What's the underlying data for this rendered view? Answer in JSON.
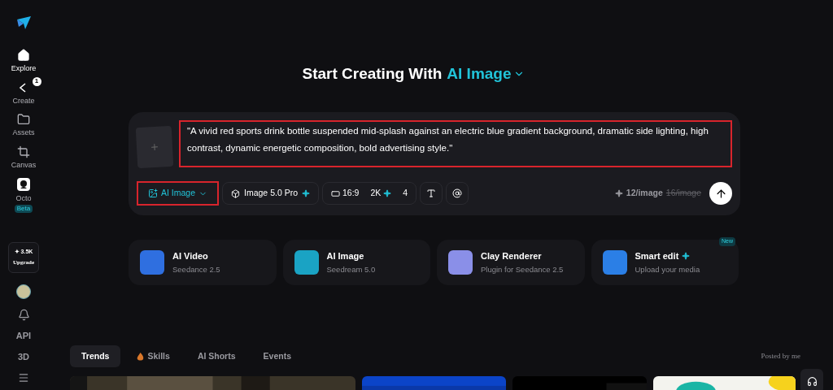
{
  "sidebar": {
    "items": [
      {
        "label": "Explore",
        "selected": true
      },
      {
        "label": "Create",
        "selected": false,
        "badge": "1"
      },
      {
        "label": "Assets",
        "selected": false
      },
      {
        "label": "Canvas",
        "selected": false
      },
      {
        "label": "Octo",
        "selected": false,
        "tag": "Beta"
      }
    ],
    "credits": {
      "amount": "✦ 3.5K",
      "action": "Upgrade"
    },
    "bottom": [
      {
        "kind": "avatar"
      },
      {
        "kind": "bell"
      },
      {
        "kind": "text",
        "label": "API"
      },
      {
        "kind": "text",
        "label": "3D"
      },
      {
        "kind": "menu"
      }
    ]
  },
  "heading": {
    "text": "Start Creating With",
    "mode": "AI Image"
  },
  "prompt": {
    "value": "\"A vivid red sports drink bottle suspended mid-splash against an electric blue gradient background, dramatic side lighting, high contrast, dynamic energetic composition, bold advertising style.\"",
    "highlighted": true
  },
  "toolbar": {
    "mode": {
      "label": "AI Image",
      "highlighted": true
    },
    "model": "Image 5.0 Pro",
    "ratio": "16:9",
    "resolution": "2K",
    "count": "4",
    "cost": "12/image",
    "old_cost": "16/image"
  },
  "tools": [
    {
      "title": "AI Video",
      "subtitle": "Seedance 2.5",
      "color": "#2f6fe0",
      "plus": false
    },
    {
      "title": "AI Image",
      "subtitle": "Seedream 5.0",
      "color": "#1aa3c4",
      "plus": false
    },
    {
      "title": "Clay Renderer",
      "subtitle": "Plugin for Seedance 2.5",
      "color": "#8a8fe8",
      "plus": false
    },
    {
      "title": "Smart edit",
      "subtitle": "Upload your media",
      "color": "#2b7fe6",
      "plus": true,
      "tag": "New"
    }
  ],
  "tabs": [
    {
      "label": "Trends",
      "selected": true
    },
    {
      "label": "Skills",
      "selected": false,
      "fire": true
    },
    {
      "label": "AI Shorts",
      "selected": false
    },
    {
      "label": "Events",
      "selected": false
    }
  ],
  "filter": "Posted by me"
}
